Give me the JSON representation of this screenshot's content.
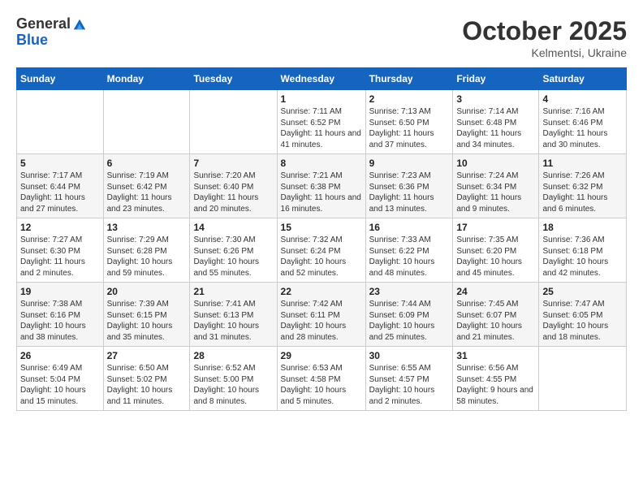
{
  "logo": {
    "general": "General",
    "blue": "Blue"
  },
  "title": "October 2025",
  "subtitle": "Kelmentsi, Ukraine",
  "days_header": [
    "Sunday",
    "Monday",
    "Tuesday",
    "Wednesday",
    "Thursday",
    "Friday",
    "Saturday"
  ],
  "weeks": [
    [
      {
        "day": "",
        "info": ""
      },
      {
        "day": "",
        "info": ""
      },
      {
        "day": "",
        "info": ""
      },
      {
        "day": "1",
        "info": "Sunrise: 7:11 AM\nSunset: 6:52 PM\nDaylight: 11 hours and 41 minutes."
      },
      {
        "day": "2",
        "info": "Sunrise: 7:13 AM\nSunset: 6:50 PM\nDaylight: 11 hours and 37 minutes."
      },
      {
        "day": "3",
        "info": "Sunrise: 7:14 AM\nSunset: 6:48 PM\nDaylight: 11 hours and 34 minutes."
      },
      {
        "day": "4",
        "info": "Sunrise: 7:16 AM\nSunset: 6:46 PM\nDaylight: 11 hours and 30 minutes."
      }
    ],
    [
      {
        "day": "5",
        "info": "Sunrise: 7:17 AM\nSunset: 6:44 PM\nDaylight: 11 hours and 27 minutes."
      },
      {
        "day": "6",
        "info": "Sunrise: 7:19 AM\nSunset: 6:42 PM\nDaylight: 11 hours and 23 minutes."
      },
      {
        "day": "7",
        "info": "Sunrise: 7:20 AM\nSunset: 6:40 PM\nDaylight: 11 hours and 20 minutes."
      },
      {
        "day": "8",
        "info": "Sunrise: 7:21 AM\nSunset: 6:38 PM\nDaylight: 11 hours and 16 minutes."
      },
      {
        "day": "9",
        "info": "Sunrise: 7:23 AM\nSunset: 6:36 PM\nDaylight: 11 hours and 13 minutes."
      },
      {
        "day": "10",
        "info": "Sunrise: 7:24 AM\nSunset: 6:34 PM\nDaylight: 11 hours and 9 minutes."
      },
      {
        "day": "11",
        "info": "Sunrise: 7:26 AM\nSunset: 6:32 PM\nDaylight: 11 hours and 6 minutes."
      }
    ],
    [
      {
        "day": "12",
        "info": "Sunrise: 7:27 AM\nSunset: 6:30 PM\nDaylight: 11 hours and 2 minutes."
      },
      {
        "day": "13",
        "info": "Sunrise: 7:29 AM\nSunset: 6:28 PM\nDaylight: 10 hours and 59 minutes."
      },
      {
        "day": "14",
        "info": "Sunrise: 7:30 AM\nSunset: 6:26 PM\nDaylight: 10 hours and 55 minutes."
      },
      {
        "day": "15",
        "info": "Sunrise: 7:32 AM\nSunset: 6:24 PM\nDaylight: 10 hours and 52 minutes."
      },
      {
        "day": "16",
        "info": "Sunrise: 7:33 AM\nSunset: 6:22 PM\nDaylight: 10 hours and 48 minutes."
      },
      {
        "day": "17",
        "info": "Sunrise: 7:35 AM\nSunset: 6:20 PM\nDaylight: 10 hours and 45 minutes."
      },
      {
        "day": "18",
        "info": "Sunrise: 7:36 AM\nSunset: 6:18 PM\nDaylight: 10 hours and 42 minutes."
      }
    ],
    [
      {
        "day": "19",
        "info": "Sunrise: 7:38 AM\nSunset: 6:16 PM\nDaylight: 10 hours and 38 minutes."
      },
      {
        "day": "20",
        "info": "Sunrise: 7:39 AM\nSunset: 6:15 PM\nDaylight: 10 hours and 35 minutes."
      },
      {
        "day": "21",
        "info": "Sunrise: 7:41 AM\nSunset: 6:13 PM\nDaylight: 10 hours and 31 minutes."
      },
      {
        "day": "22",
        "info": "Sunrise: 7:42 AM\nSunset: 6:11 PM\nDaylight: 10 hours and 28 minutes."
      },
      {
        "day": "23",
        "info": "Sunrise: 7:44 AM\nSunset: 6:09 PM\nDaylight: 10 hours and 25 minutes."
      },
      {
        "day": "24",
        "info": "Sunrise: 7:45 AM\nSunset: 6:07 PM\nDaylight: 10 hours and 21 minutes."
      },
      {
        "day": "25",
        "info": "Sunrise: 7:47 AM\nSunset: 6:05 PM\nDaylight: 10 hours and 18 minutes."
      }
    ],
    [
      {
        "day": "26",
        "info": "Sunrise: 6:49 AM\nSunset: 5:04 PM\nDaylight: 10 hours and 15 minutes."
      },
      {
        "day": "27",
        "info": "Sunrise: 6:50 AM\nSunset: 5:02 PM\nDaylight: 10 hours and 11 minutes."
      },
      {
        "day": "28",
        "info": "Sunrise: 6:52 AM\nSunset: 5:00 PM\nDaylight: 10 hours and 8 minutes."
      },
      {
        "day": "29",
        "info": "Sunrise: 6:53 AM\nSunset: 4:58 PM\nDaylight: 10 hours and 5 minutes."
      },
      {
        "day": "30",
        "info": "Sunrise: 6:55 AM\nSunset: 4:57 PM\nDaylight: 10 hours and 2 minutes."
      },
      {
        "day": "31",
        "info": "Sunrise: 6:56 AM\nSunset: 4:55 PM\nDaylight: 9 hours and 58 minutes."
      },
      {
        "day": "",
        "info": ""
      }
    ]
  ]
}
